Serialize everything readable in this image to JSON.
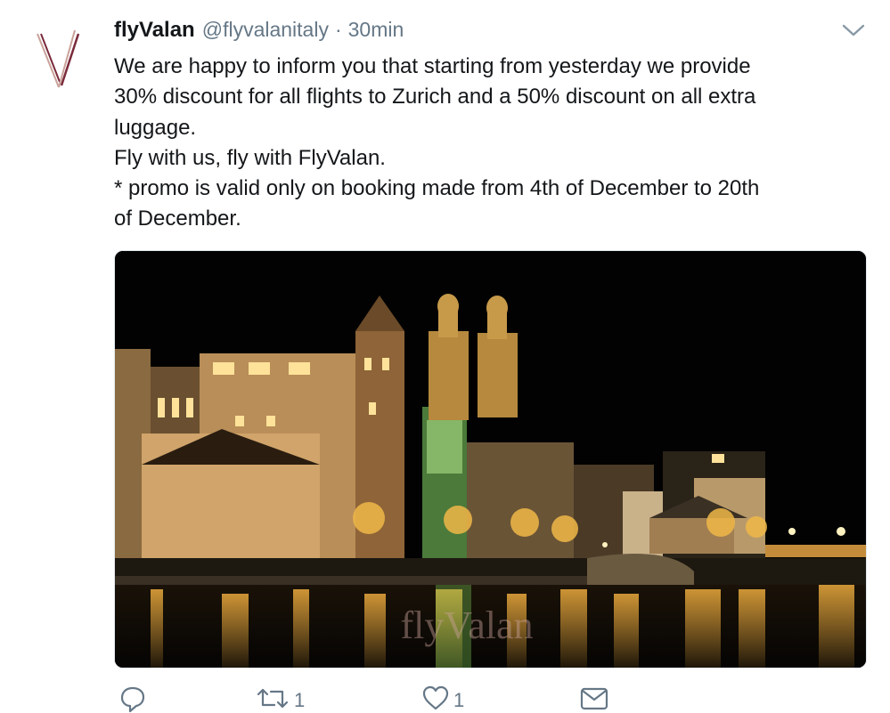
{
  "tweet": {
    "display_name": "flyValan",
    "handle": "@flyvalanitaly",
    "separator": "·",
    "time": "30min",
    "lines": [
      "We are happy to inform you that starting from yesterday we provide",
      "30% discount for all flights to Zurich and a 50% discount on all extra",
      "luggage.",
      "Fly with us, fly with FlyValan.",
      "* promo is valid only on booking made from 4th of December to 20th",
      "of December."
    ],
    "media": {
      "watermark": "flyValan"
    }
  },
  "actions": {
    "reply_icon": "reply-icon",
    "retweet_icon": "retweet-icon",
    "retweet_count": "1",
    "like_icon": "heart-icon",
    "like_count": "1",
    "dm_icon": "envelope-icon"
  },
  "colors": {
    "text": "#14171a",
    "secondary": "#657786",
    "logo_dark": "#7a2a3a",
    "logo_light": "#c9a29a"
  }
}
